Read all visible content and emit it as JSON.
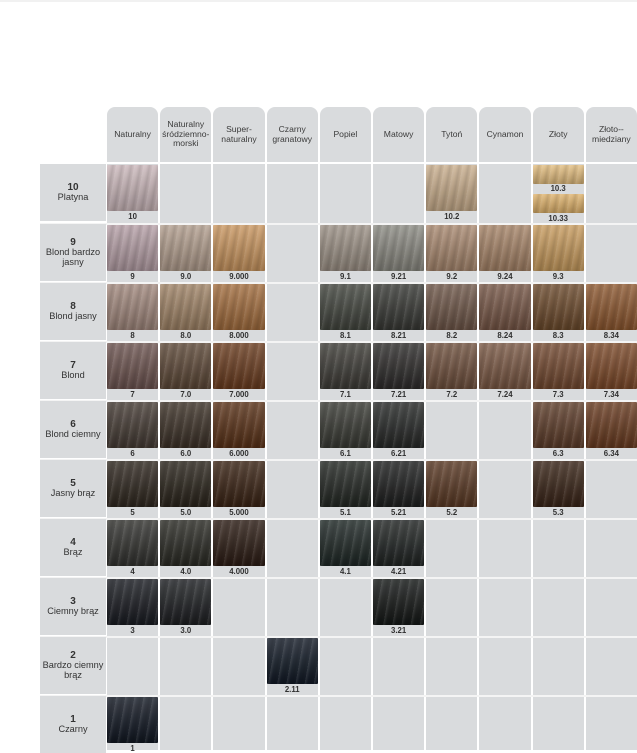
{
  "columns": [
    {
      "id": "c1",
      "label": "Naturalny"
    },
    {
      "id": "c2",
      "label": "Naturalny śródziemno-morski"
    },
    {
      "id": "c3",
      "label": "Super-naturalny"
    },
    {
      "id": "c4",
      "label": "Czarny granatowy"
    },
    {
      "id": "c5",
      "label": "Popiel"
    },
    {
      "id": "c6",
      "label": "Matowy"
    },
    {
      "id": "c7",
      "label": "Tytoń"
    },
    {
      "id": "c8",
      "label": "Cynamon"
    },
    {
      "id": "c9",
      "label": "Złoty"
    },
    {
      "id": "c10",
      "label": "Złoto--miedziany"
    }
  ],
  "rows": [
    {
      "level": "10",
      "name": "Platyna",
      "shades": [
        {
          "col": 0,
          "code": "10",
          "color": "#c9b6b9"
        },
        {
          "col": 6,
          "code": "10.2",
          "color": "#c8ad8c"
        },
        {
          "col": 8,
          "code": "10.3",
          "color": "#e2bd7f",
          "split": "top"
        },
        {
          "col": 8,
          "code": "10.33",
          "color": "#deb26c",
          "split": "bottom"
        }
      ]
    },
    {
      "level": "9",
      "name": "Blond bardzo jasny",
      "shades": [
        {
          "col": 0,
          "code": "9",
          "color": "#b49ea5"
        },
        {
          "col": 1,
          "code": "9.0",
          "color": "#b19d8d"
        },
        {
          "col": 2,
          "code": "9.000",
          "color": "#c8955f"
        },
        {
          "col": 4,
          "code": "9.1",
          "color": "#9b9085"
        },
        {
          "col": 5,
          "code": "9.21",
          "color": "#8b8a82"
        },
        {
          "col": 6,
          "code": "9.2",
          "color": "#a8886f"
        },
        {
          "col": 7,
          "code": "9.24",
          "color": "#a58367"
        },
        {
          "col": 8,
          "code": "9.3",
          "color": "#c79b5e"
        }
      ]
    },
    {
      "level": "8",
      "name": "Blond jasny",
      "shades": [
        {
          "col": 0,
          "code": "8",
          "color": "#a1887d"
        },
        {
          "col": 1,
          "code": "8.0",
          "color": "#9f8366"
        },
        {
          "col": 2,
          "code": "8.000",
          "color": "#a26d3e"
        },
        {
          "col": 4,
          "code": "8.1",
          "color": "#43463f"
        },
        {
          "col": 5,
          "code": "8.21",
          "color": "#393a36"
        },
        {
          "col": 6,
          "code": "8.2",
          "color": "#6f5749"
        },
        {
          "col": 7,
          "code": "8.24",
          "color": "#765646"
        },
        {
          "col": 8,
          "code": "8.3",
          "color": "#6d4b2d"
        },
        {
          "col": 9,
          "code": "8.34",
          "color": "#8d5830"
        }
      ]
    },
    {
      "level": "7",
      "name": "Blond",
      "shades": [
        {
          "col": 0,
          "code": "7",
          "color": "#6e5551"
        },
        {
          "col": 1,
          "code": "7.0",
          "color": "#5e4938"
        },
        {
          "col": 2,
          "code": "7.000",
          "color": "#6b3d20"
        },
        {
          "col": 4,
          "code": "7.1",
          "color": "#3f3d38"
        },
        {
          "col": 5,
          "code": "7.21",
          "color": "#2f2d2c"
        },
        {
          "col": 6,
          "code": "7.2",
          "color": "#70513e"
        },
        {
          "col": 7,
          "code": "7.24",
          "color": "#7a5844"
        },
        {
          "col": 8,
          "code": "7.3",
          "color": "#744a31"
        },
        {
          "col": 9,
          "code": "7.34",
          "color": "#7d4a2a"
        }
      ]
    },
    {
      "level": "6",
      "name": "Blond ciemny",
      "shades": [
        {
          "col": 0,
          "code": "6",
          "color": "#463c35"
        },
        {
          "col": 1,
          "code": "6.0",
          "color": "#3d3228"
        },
        {
          "col": 2,
          "code": "6.000",
          "color": "#5a3218"
        },
        {
          "col": 4,
          "code": "6.1",
          "color": "#3a3b35"
        },
        {
          "col": 5,
          "code": "6.21",
          "color": "#282a29"
        },
        {
          "col": 8,
          "code": "6.3",
          "color": "#5e3d2a"
        },
        {
          "col": 9,
          "code": "6.34",
          "color": "#6a3c21"
        }
      ]
    },
    {
      "level": "5",
      "name": "Jasny brąz",
      "shades": [
        {
          "col": 0,
          "code": "5",
          "color": "#302820"
        },
        {
          "col": 1,
          "code": "5.0",
          "color": "#2b251c"
        },
        {
          "col": 2,
          "code": "5.000",
          "color": "#3a2314"
        },
        {
          "col": 4,
          "code": "5.1",
          "color": "#242824"
        },
        {
          "col": 5,
          "code": "5.21",
          "color": "#1f2020"
        },
        {
          "col": 6,
          "code": "5.2",
          "color": "#5b3a25"
        },
        {
          "col": 8,
          "code": "5.3",
          "color": "#3a2518"
        }
      ]
    },
    {
      "level": "4",
      "name": "Brąz",
      "shades": [
        {
          "col": 0,
          "code": "4",
          "color": "#333330"
        },
        {
          "col": 1,
          "code": "4.0",
          "color": "#2b2b25"
        },
        {
          "col": 2,
          "code": "4.000",
          "color": "#2c1c14"
        },
        {
          "col": 4,
          "code": "4.1",
          "color": "#1f2826"
        },
        {
          "col": 5,
          "code": "4.21",
          "color": "#212524"
        }
      ]
    },
    {
      "level": "3",
      "name": "Ciemny brąz",
      "shades": [
        {
          "col": 0,
          "code": "3",
          "color": "#1a1c22"
        },
        {
          "col": 1,
          "code": "3.0",
          "color": "#1e2023"
        },
        {
          "col": 5,
          "code": "3.21",
          "color": "#151817"
        }
      ]
    },
    {
      "level": "2",
      "name": "Bardzo ciemny brąz",
      "shades": [
        {
          "col": 3,
          "code": "2.11",
          "color": "#121a26"
        }
      ]
    },
    {
      "level": "1",
      "name": "Czarny",
      "shades": [
        {
          "col": 0,
          "code": "1",
          "color": "#121823"
        }
      ]
    }
  ]
}
